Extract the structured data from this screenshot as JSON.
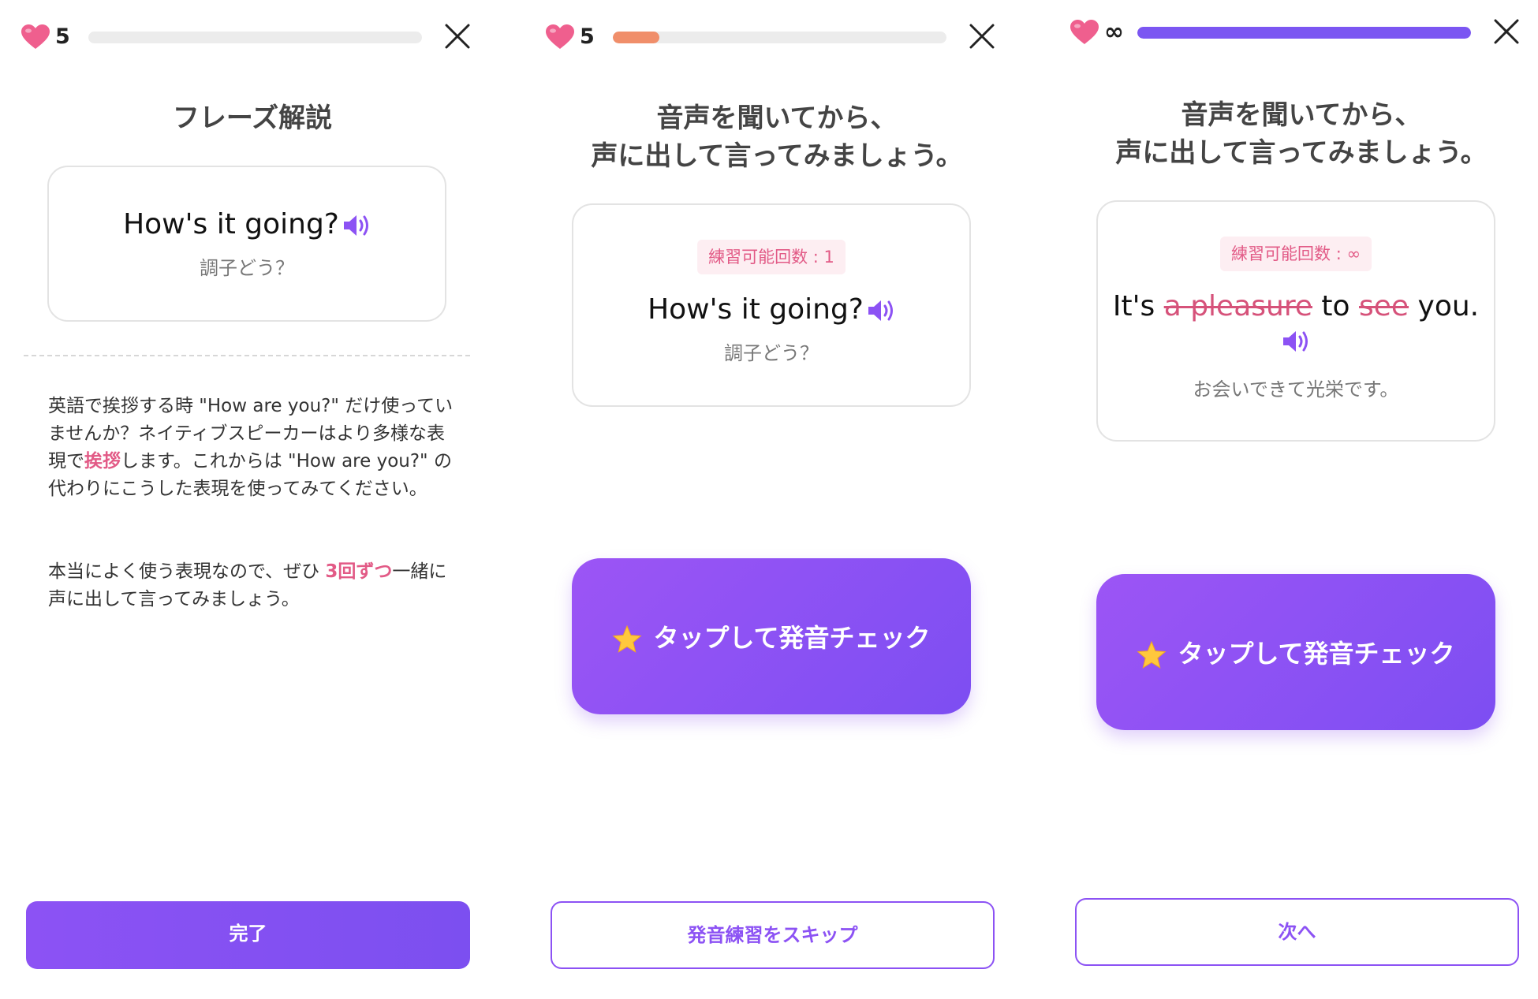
{
  "colors": {
    "accent": "#8c52f4",
    "pink": "#e25a86",
    "progress_orange": "#f08e6a",
    "progress_purple": "#7b56f2"
  },
  "icons": {
    "lives": "heart-icon",
    "close": "close-icon",
    "audio": "speaker-icon",
    "check": "star-icon"
  },
  "panels": [
    {
      "lives": "5",
      "progress": 0,
      "heading": "フレーズ解説",
      "phrase": "How's it going?",
      "translation": "調子どう？",
      "explanation": {
        "p1_a": "英語で挨拶する時 \"How are you?\" だけ使っていませんか？ネイティブスピーカーはより多様な表現で",
        "p1_hl": "挨拶",
        "p1_b": "します。これからは \"How are you?\" の代わりにこうした表現を使ってみてください。",
        "p2_a": "本当によく使う表現なので、ぜひ ",
        "p2_hl": "3回ずつ",
        "p2_b": "一緒に声に出して言ってみましょう。"
      },
      "bottom_button": "完了"
    },
    {
      "lives": "5",
      "progress": 0.14,
      "heading_line1": "音声を聞いてから、",
      "heading_line2": "声に出して言ってみましょう。",
      "badge": "練習可能回数 : 1",
      "phrase": "How's it going?",
      "translation": "調子どう？",
      "check_button": "タップして発音チェック",
      "bottom_button": "発音練習をスキップ"
    },
    {
      "lives": "∞",
      "progress": 1.0,
      "heading_line1": "音声を聞いてから、",
      "heading_line2": "声に出して言ってみましょう。",
      "badge": "練習可能回数 : ∞",
      "phrase_parts": [
        "It's ",
        "a pleasure",
        " to ",
        "see",
        " you."
      ],
      "translation": "お会いできて光栄です。",
      "check_button": "タップして発音チェック",
      "bottom_button": "次へ"
    }
  ]
}
